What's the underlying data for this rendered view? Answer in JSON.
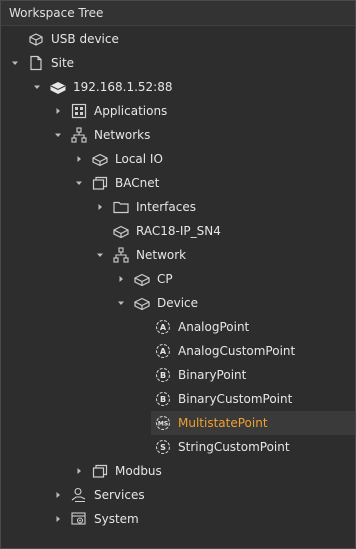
{
  "panel": {
    "title": "Workspace Tree"
  },
  "tree": {
    "usb_device": "USB device",
    "site": "Site",
    "ip": "192.168.1.52:88",
    "applications": "Applications",
    "networks": "Networks",
    "local_io": "Local IO",
    "bacnet": "BACnet",
    "interfaces": "Interfaces",
    "rac18": "RAC18-IP_SN4",
    "network": "Network",
    "cp": "CP",
    "device": "Device",
    "analog_point": "AnalogPoint",
    "analog_custom_point": "AnalogCustomPoint",
    "binary_point": "BinaryPoint",
    "binary_custom_point": "BinaryCustomPoint",
    "multistate_point": "MultistatePoint",
    "string_custom_point": "StringCustomPoint",
    "modbus": "Modbus",
    "services": "Services",
    "system": "System"
  },
  "icon_glyphs": {
    "analog": "A",
    "binary": "B",
    "multistate": "MS",
    "string": "S"
  },
  "colors": {
    "selected_text": "#f0a030",
    "selected_row": "#3a3a3a"
  }
}
